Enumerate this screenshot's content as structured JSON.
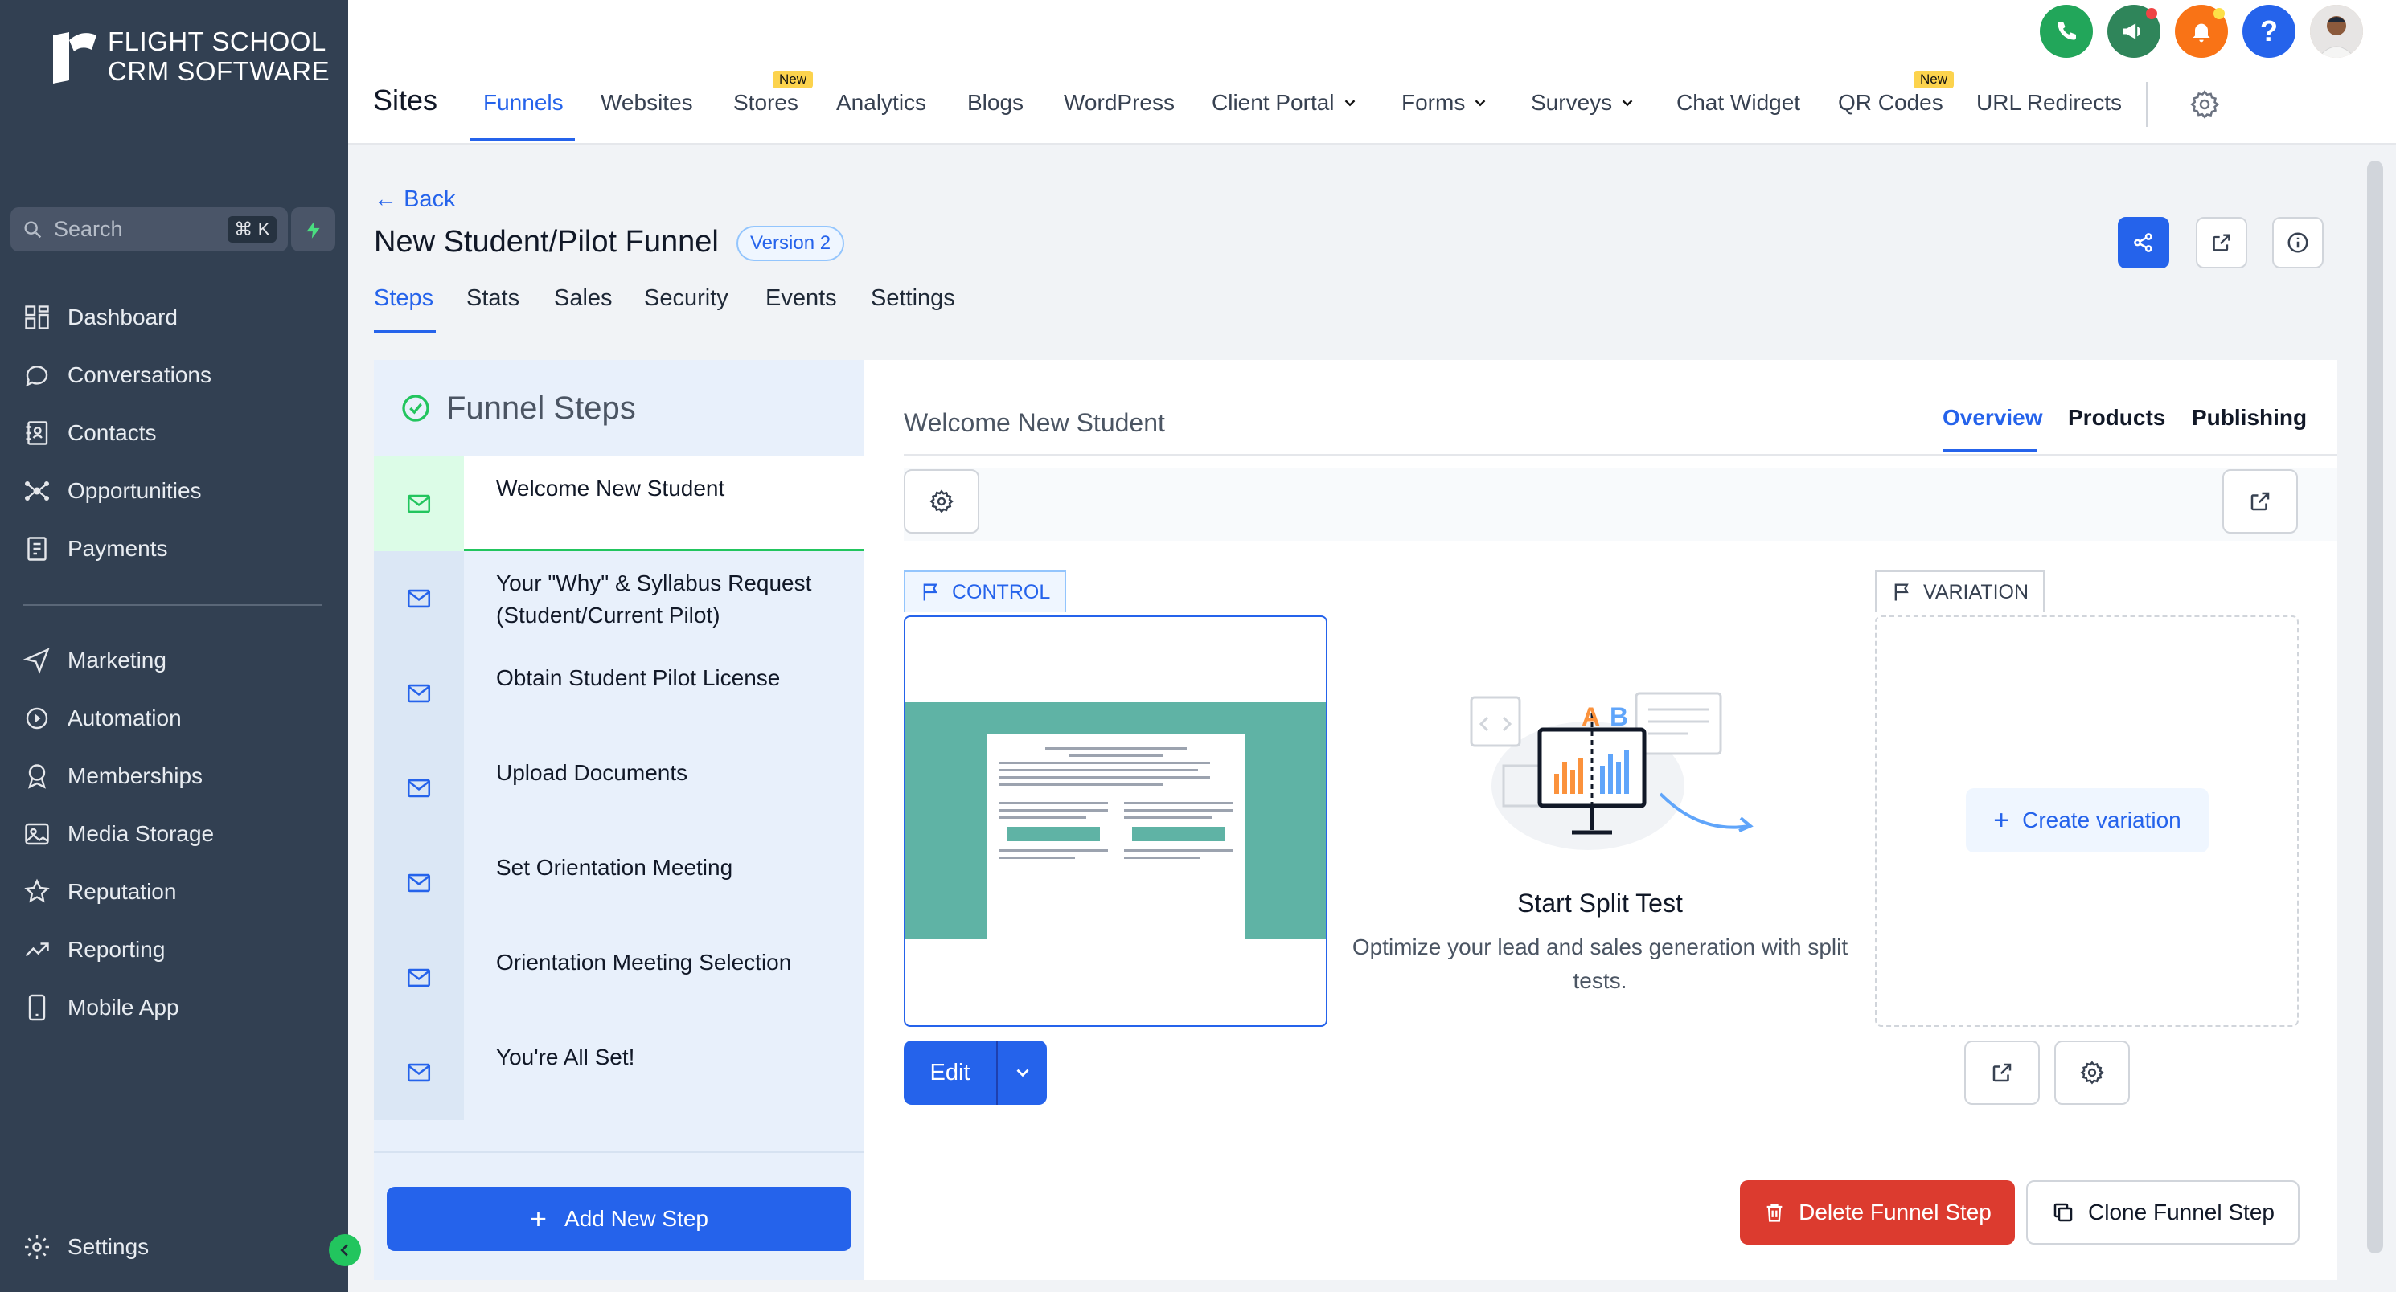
{
  "sidebar": {
    "logo_line1": "FLIGHT SCHOOL",
    "logo_line2": "CRM SOFTWARE",
    "search_placeholder": "Search",
    "search_shortcut": "⌘ K",
    "items": [
      {
        "label": "Dashboard",
        "icon": "dashboard-icon"
      },
      {
        "label": "Conversations",
        "icon": "chat-bubble-icon"
      },
      {
        "label": "Contacts",
        "icon": "contacts-icon"
      },
      {
        "label": "Opportunities",
        "icon": "opportunities-icon"
      },
      {
        "label": "Payments",
        "icon": "payments-icon"
      },
      {
        "label": "Marketing",
        "icon": "send-icon"
      },
      {
        "label": "Automation",
        "icon": "automation-icon"
      },
      {
        "label": "Memberships",
        "icon": "membership-icon"
      },
      {
        "label": "Media Storage",
        "icon": "image-icon"
      },
      {
        "label": "Reputation",
        "icon": "star-icon"
      },
      {
        "label": "Reporting",
        "icon": "trend-icon"
      },
      {
        "label": "Mobile App",
        "icon": "phone-icon"
      }
    ],
    "settings_label": "Settings"
  },
  "topbar": {
    "section_title": "Sites",
    "nav": [
      {
        "label": "Funnels",
        "active": true
      },
      {
        "label": "Websites"
      },
      {
        "label": "Stores",
        "badge": "New"
      },
      {
        "label": "Analytics"
      },
      {
        "label": "Blogs"
      },
      {
        "label": "WordPress"
      },
      {
        "label": "Client Portal",
        "dropdown": true
      },
      {
        "label": "Forms",
        "dropdown": true
      },
      {
        "label": "Surveys",
        "dropdown": true
      },
      {
        "label": "Chat Widget"
      },
      {
        "label": "QR Codes",
        "badge": "New"
      },
      {
        "label": "URL Redirects"
      }
    ],
    "help_glyph": "?"
  },
  "funnel": {
    "back_label": "Back",
    "title": "New Student/Pilot Funnel",
    "version": "Version 2",
    "tabs": [
      "Steps",
      "Stats",
      "Sales",
      "Security",
      "Events",
      "Settings"
    ],
    "active_tab": "Steps"
  },
  "steps_panel": {
    "heading": "Funnel Steps",
    "steps": [
      "Welcome New Student",
      "Your \"Why\" & Syllabus Request (Student/Current Pilot)",
      "Obtain Student Pilot License",
      "Upload Documents",
      "Set Orientation Meeting",
      "Orientation Meeting Selection",
      "You're All Set!"
    ],
    "add_label": "Add New Step"
  },
  "detail": {
    "step_title": "Welcome New Student",
    "tabs": [
      "Overview",
      "Products",
      "Publishing"
    ],
    "active_tab": "Overview",
    "control_label": "CONTROL",
    "variation_label": "VARIATION",
    "create_variation": "Create variation",
    "split_title": "Start Split Test",
    "split_subtitle": "Optimize your lead and sales generation with split tests.",
    "split_a": "A",
    "split_b": "B",
    "edit_label": "Edit",
    "delete_label": "Delete Funnel Step",
    "clone_label": "Clone Funnel Step"
  },
  "colors": {
    "sidebar_bg": "#324052",
    "accent": "#2563eb",
    "danger": "#dc3b2f",
    "success": "#22c55e",
    "preview_bg": "#5fb3a5"
  }
}
